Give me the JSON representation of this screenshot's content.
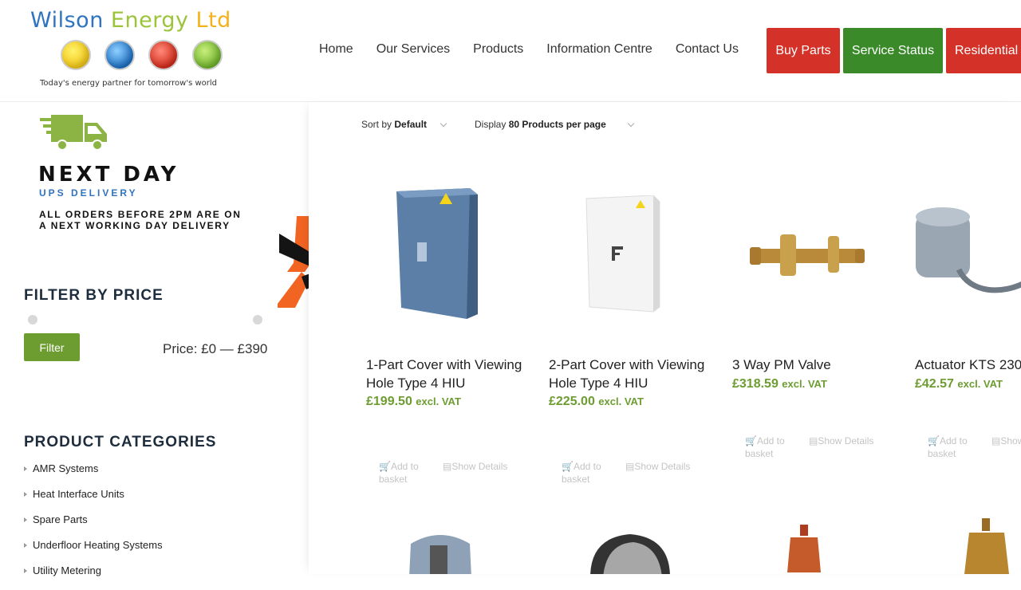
{
  "header": {
    "logo": {
      "word1": "Wilson",
      "word2": "Energy",
      "word3": "Ltd",
      "tagline": "Today's energy partner for tomorrow's world"
    },
    "nav": [
      "Home",
      "Our Services",
      "Products",
      "Information Centre",
      "Contact Us"
    ],
    "buttons": {
      "buy_parts": "Buy Parts",
      "service_status": "Service Status",
      "residential": "Residential"
    }
  },
  "sidebar": {
    "delivery": {
      "headline": "NEXT DAY",
      "subline": "UPS DELIVERY",
      "line1": "ALL ORDERS BEFORE 2PM ARE ON",
      "line2": "A NEXT WORKING DAY DELIVERY"
    },
    "filter_title": "FILTER BY PRICE",
    "filter_button": "Filter",
    "price_range": "Price: £0 — £390",
    "categories_title": "PRODUCT CATEGORIES",
    "categories": [
      "AMR Systems",
      "Heat Interface Units",
      "Spare Parts",
      "Underfloor Heating Systems",
      "Utility Metering"
    ]
  },
  "toolbar": {
    "sort_prefix": "Sort by",
    "sort_value": "Default",
    "display_prefix": "Display",
    "display_value": "80 Products per page"
  },
  "products": [
    {
      "name": "1-Part Cover with Viewing Hole Type 4 HIU",
      "price": "£199.50",
      "vat": "excl. VAT",
      "add": "Add to basket",
      "details": "Show Details"
    },
    {
      "name": "2-Part Cover with Viewing Hole Type 4 HIU",
      "price": "£225.00",
      "vat": "excl. VAT",
      "add": "Add to basket",
      "details": "Show Details"
    },
    {
      "name": "3 Way PM Valve",
      "price": "£318.59",
      "vat": "excl. VAT",
      "add": "Add to basket",
      "details": "Show Details"
    },
    {
      "name": "Actuator KTS 230",
      "price": "£42.57",
      "vat": "excl. VAT",
      "add": "Add to basket",
      "details": "Show"
    }
  ],
  "colors": {
    "green": "#6d9d31",
    "red": "#d43129",
    "service_green": "#3a8a2a",
    "brand_blue": "#2f74c0"
  }
}
